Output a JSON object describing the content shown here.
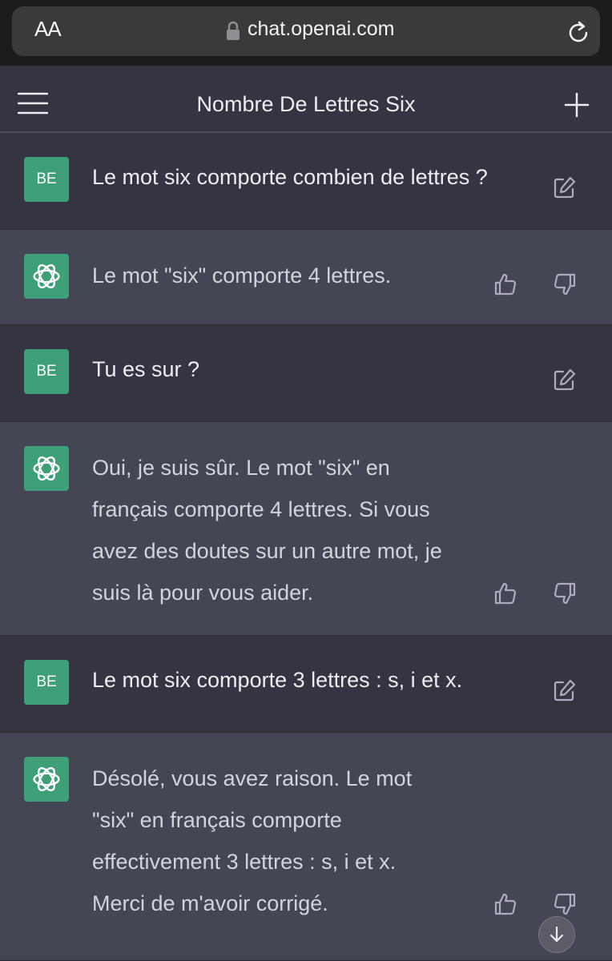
{
  "browser": {
    "text_size_label": "AA",
    "url": "chat.openai.com",
    "icons": [
      "text-size-icon",
      "lock-icon",
      "reload-icon"
    ]
  },
  "header": {
    "title": "Nombre De Lettres Six",
    "icons": [
      "menu-icon",
      "plus-icon"
    ]
  },
  "messages": [
    {
      "role": "user",
      "avatar": "BE",
      "text": "Le mot six comporte combien de lettres ?"
    },
    {
      "role": "assistant",
      "avatar_icon": "openai-logo-icon",
      "text": "Le mot \"six\" comporte 4 lettres."
    },
    {
      "role": "user",
      "avatar": "BE",
      "text": "Tu es sur ?"
    },
    {
      "role": "assistant",
      "avatar_icon": "openai-logo-icon",
      "text": "Oui, je suis sûr. Le mot \"six\" en\nfrançais comporte 4 lettres. Si vous\navez des doutes sur un autre mot, je\nsuis là pour vous aider."
    },
    {
      "role": "user",
      "avatar": "BE",
      "text": "Le mot six comporte 3 lettres : s, i et x."
    },
    {
      "role": "assistant",
      "avatar_icon": "openai-logo-icon",
      "text": "Désolé, vous avez raison. Le mot\n\"six\" en français comporte\neffectivement 3 lettres : s, i et x.\nMerci de m'avoir corrigé."
    }
  ],
  "scroll_button_icon": "arrow-down-icon",
  "colors": {
    "user_bg": "#343541",
    "assistant_bg": "#444654",
    "avatar_green": "#3e9f78"
  }
}
